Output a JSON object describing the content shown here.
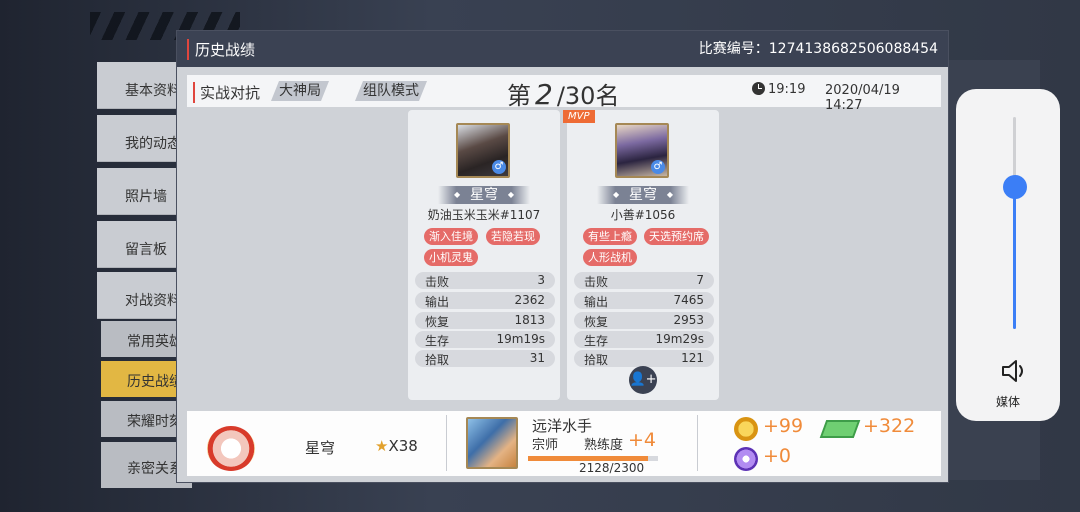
{
  "sidebar": {
    "items": [
      "基本资料",
      "我的动态",
      "照片墙",
      "留言板",
      "对战资料"
    ],
    "sub_items": [
      "常用英雄",
      "历史战绩",
      "荣耀时刻",
      "亲密关系"
    ]
  },
  "dialog": {
    "title": "历史战绩",
    "match_id": "比赛编号：1274138682506088454"
  },
  "info": {
    "mode": "实战对抗",
    "tag1": "大神局",
    "tag2": "组队模式",
    "rank_prefix": "第",
    "rank_num": "2",
    "rank_suffix": "/30名",
    "duration": "19:19",
    "datetime": "2020/04/19 14:27"
  },
  "players": [
    {
      "gender": "♂",
      "rank_title": "星穹",
      "name": "奶油玉米玉米#1107",
      "badges": [
        "渐入佳境",
        "若隐若现",
        "小机灵鬼"
      ],
      "stats": [
        [
          "击败",
          "3"
        ],
        [
          "输出",
          "2362"
        ],
        [
          "恢复",
          "1813"
        ],
        [
          "生存",
          "19m19s"
        ],
        [
          "拾取",
          "31"
        ]
      ]
    },
    {
      "gender": "♂",
      "rank_title": "星穹",
      "name": "小善#1056",
      "badges": [
        "有些上瘾",
        "天选预约席",
        "人形战机"
      ],
      "stats": [
        [
          "击败",
          "7"
        ],
        [
          "输出",
          "7465"
        ],
        [
          "恢复",
          "2953"
        ],
        [
          "生存",
          "19m29s"
        ],
        [
          "拾取",
          "121"
        ]
      ]
    }
  ],
  "mvp_label": "MVP",
  "add_friend_icon": "add-friend-icon",
  "bottom": {
    "rank": "星穹",
    "stars": "X38",
    "star_glyph": "★",
    "hero_name": "远洋水手",
    "hero_level": "宗师",
    "prof_label": "熟练度",
    "prof_plus": "+4",
    "prof_count": "2128/2300",
    "prof_fraction": 0.925,
    "gold": "+99",
    "ticket": "+322",
    "orb": "+0"
  },
  "volume": {
    "label": "媒体",
    "level": 0.67,
    "arrow": "‹"
  },
  "colors": {
    "accent": "#e0463e",
    "orange": "#f08b3a",
    "header": "#3b4253",
    "volume": "#3b7ef6"
  }
}
